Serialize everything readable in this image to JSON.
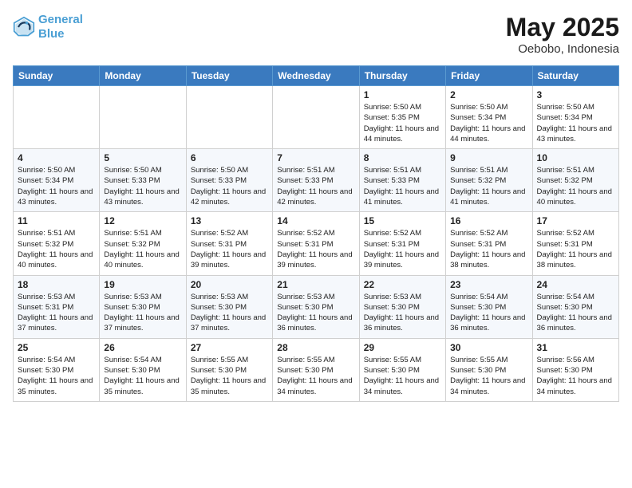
{
  "logo": {
    "line1": "General",
    "line2": "Blue"
  },
  "title": "May 2025",
  "subtitle": "Oebobo, Indonesia",
  "weekdays": [
    "Sunday",
    "Monday",
    "Tuesday",
    "Wednesday",
    "Thursday",
    "Friday",
    "Saturday"
  ],
  "weeks": [
    [
      {
        "day": "",
        "info": ""
      },
      {
        "day": "",
        "info": ""
      },
      {
        "day": "",
        "info": ""
      },
      {
        "day": "",
        "info": ""
      },
      {
        "day": "1",
        "info": "Sunrise: 5:50 AM\nSunset: 5:35 PM\nDaylight: 11 hours and 44 minutes."
      },
      {
        "day": "2",
        "info": "Sunrise: 5:50 AM\nSunset: 5:34 PM\nDaylight: 11 hours and 44 minutes."
      },
      {
        "day": "3",
        "info": "Sunrise: 5:50 AM\nSunset: 5:34 PM\nDaylight: 11 hours and 43 minutes."
      }
    ],
    [
      {
        "day": "4",
        "info": "Sunrise: 5:50 AM\nSunset: 5:34 PM\nDaylight: 11 hours and 43 minutes."
      },
      {
        "day": "5",
        "info": "Sunrise: 5:50 AM\nSunset: 5:33 PM\nDaylight: 11 hours and 43 minutes."
      },
      {
        "day": "6",
        "info": "Sunrise: 5:50 AM\nSunset: 5:33 PM\nDaylight: 11 hours and 42 minutes."
      },
      {
        "day": "7",
        "info": "Sunrise: 5:51 AM\nSunset: 5:33 PM\nDaylight: 11 hours and 42 minutes."
      },
      {
        "day": "8",
        "info": "Sunrise: 5:51 AM\nSunset: 5:33 PM\nDaylight: 11 hours and 41 minutes."
      },
      {
        "day": "9",
        "info": "Sunrise: 5:51 AM\nSunset: 5:32 PM\nDaylight: 11 hours and 41 minutes."
      },
      {
        "day": "10",
        "info": "Sunrise: 5:51 AM\nSunset: 5:32 PM\nDaylight: 11 hours and 40 minutes."
      }
    ],
    [
      {
        "day": "11",
        "info": "Sunrise: 5:51 AM\nSunset: 5:32 PM\nDaylight: 11 hours and 40 minutes."
      },
      {
        "day": "12",
        "info": "Sunrise: 5:51 AM\nSunset: 5:32 PM\nDaylight: 11 hours and 40 minutes."
      },
      {
        "day": "13",
        "info": "Sunrise: 5:52 AM\nSunset: 5:31 PM\nDaylight: 11 hours and 39 minutes."
      },
      {
        "day": "14",
        "info": "Sunrise: 5:52 AM\nSunset: 5:31 PM\nDaylight: 11 hours and 39 minutes."
      },
      {
        "day": "15",
        "info": "Sunrise: 5:52 AM\nSunset: 5:31 PM\nDaylight: 11 hours and 39 minutes."
      },
      {
        "day": "16",
        "info": "Sunrise: 5:52 AM\nSunset: 5:31 PM\nDaylight: 11 hours and 38 minutes."
      },
      {
        "day": "17",
        "info": "Sunrise: 5:52 AM\nSunset: 5:31 PM\nDaylight: 11 hours and 38 minutes."
      }
    ],
    [
      {
        "day": "18",
        "info": "Sunrise: 5:53 AM\nSunset: 5:31 PM\nDaylight: 11 hours and 37 minutes."
      },
      {
        "day": "19",
        "info": "Sunrise: 5:53 AM\nSunset: 5:30 PM\nDaylight: 11 hours and 37 minutes."
      },
      {
        "day": "20",
        "info": "Sunrise: 5:53 AM\nSunset: 5:30 PM\nDaylight: 11 hours and 37 minutes."
      },
      {
        "day": "21",
        "info": "Sunrise: 5:53 AM\nSunset: 5:30 PM\nDaylight: 11 hours and 36 minutes."
      },
      {
        "day": "22",
        "info": "Sunrise: 5:53 AM\nSunset: 5:30 PM\nDaylight: 11 hours and 36 minutes."
      },
      {
        "day": "23",
        "info": "Sunrise: 5:54 AM\nSunset: 5:30 PM\nDaylight: 11 hours and 36 minutes."
      },
      {
        "day": "24",
        "info": "Sunrise: 5:54 AM\nSunset: 5:30 PM\nDaylight: 11 hours and 36 minutes."
      }
    ],
    [
      {
        "day": "25",
        "info": "Sunrise: 5:54 AM\nSunset: 5:30 PM\nDaylight: 11 hours and 35 minutes."
      },
      {
        "day": "26",
        "info": "Sunrise: 5:54 AM\nSunset: 5:30 PM\nDaylight: 11 hours and 35 minutes."
      },
      {
        "day": "27",
        "info": "Sunrise: 5:55 AM\nSunset: 5:30 PM\nDaylight: 11 hours and 35 minutes."
      },
      {
        "day": "28",
        "info": "Sunrise: 5:55 AM\nSunset: 5:30 PM\nDaylight: 11 hours and 34 minutes."
      },
      {
        "day": "29",
        "info": "Sunrise: 5:55 AM\nSunset: 5:30 PM\nDaylight: 11 hours and 34 minutes."
      },
      {
        "day": "30",
        "info": "Sunrise: 5:55 AM\nSunset: 5:30 PM\nDaylight: 11 hours and 34 minutes."
      },
      {
        "day": "31",
        "info": "Sunrise: 5:56 AM\nSunset: 5:30 PM\nDaylight: 11 hours and 34 minutes."
      }
    ]
  ]
}
